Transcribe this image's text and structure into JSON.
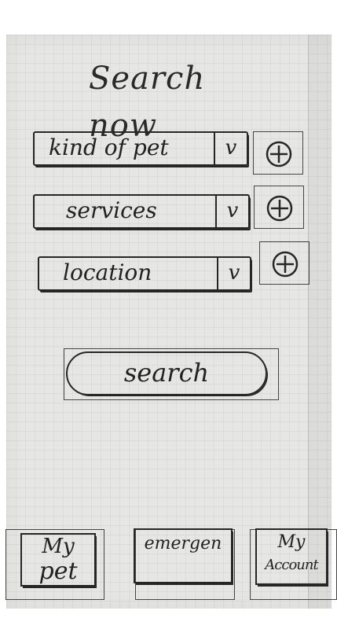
{
  "title": "Search now",
  "filters": [
    {
      "label": "kind of pet",
      "chevron": "v",
      "add_icon": "plus-circle-icon"
    },
    {
      "label": "services",
      "chevron": "v",
      "add_icon": "plus-circle-icon"
    },
    {
      "label": "location",
      "chevron": "v",
      "add_icon": "plus-circle-icon"
    }
  ],
  "search_button": {
    "label": "search"
  },
  "bottom_nav": [
    {
      "line1": "My",
      "line2": "pet"
    },
    {
      "line1": "emergen",
      "line2": ""
    },
    {
      "line1": "My",
      "line2": "Account"
    }
  ]
}
